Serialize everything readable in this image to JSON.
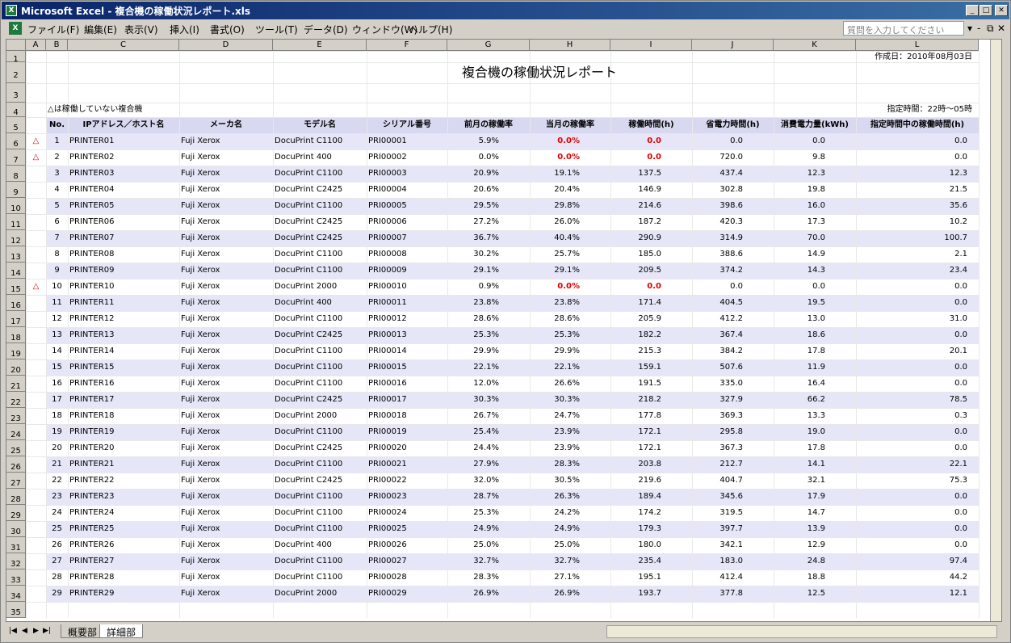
{
  "window": {
    "title": "Microsoft Excel - 複合機の稼働状況レポート.xls",
    "app_icon": "X"
  },
  "menu": {
    "items": [
      "ファイル(F)",
      "編集(E)",
      "表示(V)",
      "挿入(I)",
      "書式(O)",
      "ツール(T)",
      "データ(D)",
      "ウィンドウ(W)",
      "ヘルプ(H)"
    ],
    "help_placeholder": "質問を入力してください"
  },
  "columns": [
    "A",
    "B",
    "C",
    "D",
    "E",
    "F",
    "G",
    "H",
    "I",
    "J",
    "K",
    "L"
  ],
  "report": {
    "created": "作成日：2010年08月03日",
    "title": "複合機の稼働状況レポート",
    "legend": "△は稼働していない複合機",
    "time_range": "指定時間：22時～05時",
    "headers": [
      "No.",
      "IPアドレス／ホスト名",
      "メーカ名",
      "モデル名",
      "シリアル番号",
      "前月の稼働率",
      "当月の稼働率",
      "稼働時間(h)",
      "省電力時間(h)",
      "消費電力量(kWh)",
      "指定時間中の稼働時間(h)"
    ],
    "rows": [
      {
        "mark": "△",
        "no": "1",
        "host": "PRINTER01",
        "maker": "Fuji Xerox",
        "model": "DocuPrint C1100",
        "serial": "PRI00001",
        "prev": "5.9%",
        "curr": "0.0%",
        "hours": "0.0",
        "save": "0.0",
        "power": "0.0",
        "night": "0.0",
        "alert": true
      },
      {
        "mark": "△",
        "no": "2",
        "host": "PRINTER02",
        "maker": "Fuji Xerox",
        "model": "DocuPrint 400",
        "serial": "PRI00002",
        "prev": "0.0%",
        "curr": "0.0%",
        "hours": "0.0",
        "save": "720.0",
        "power": "9.8",
        "night": "0.0",
        "alert": true
      },
      {
        "mark": "",
        "no": "3",
        "host": "PRINTER03",
        "maker": "Fuji Xerox",
        "model": "DocuPrint C1100",
        "serial": "PRI00003",
        "prev": "20.9%",
        "curr": "19.1%",
        "hours": "137.5",
        "save": "437.4",
        "power": "12.3",
        "night": "12.3",
        "alert": false
      },
      {
        "mark": "",
        "no": "4",
        "host": "PRINTER04",
        "maker": "Fuji Xerox",
        "model": "DocuPrint C2425",
        "serial": "PRI00004",
        "prev": "20.6%",
        "curr": "20.4%",
        "hours": "146.9",
        "save": "302.8",
        "power": "19.8",
        "night": "21.5",
        "alert": false
      },
      {
        "mark": "",
        "no": "5",
        "host": "PRINTER05",
        "maker": "Fuji Xerox",
        "model": "DocuPrint C1100",
        "serial": "PRI00005",
        "prev": "29.5%",
        "curr": "29.8%",
        "hours": "214.6",
        "save": "398.6",
        "power": "16.0",
        "night": "35.6",
        "alert": false
      },
      {
        "mark": "",
        "no": "6",
        "host": "PRINTER06",
        "maker": "Fuji Xerox",
        "model": "DocuPrint C2425",
        "serial": "PRI00006",
        "prev": "27.2%",
        "curr": "26.0%",
        "hours": "187.2",
        "save": "420.3",
        "power": "17.3",
        "night": "10.2",
        "alert": false
      },
      {
        "mark": "",
        "no": "7",
        "host": "PRINTER07",
        "maker": "Fuji Xerox",
        "model": "DocuPrint C2425",
        "serial": "PRI00007",
        "prev": "36.7%",
        "curr": "40.4%",
        "hours": "290.9",
        "save": "314.9",
        "power": "70.0",
        "night": "100.7",
        "alert": false
      },
      {
        "mark": "",
        "no": "8",
        "host": "PRINTER08",
        "maker": "Fuji Xerox",
        "model": "DocuPrint C1100",
        "serial": "PRI00008",
        "prev": "30.2%",
        "curr": "25.7%",
        "hours": "185.0",
        "save": "388.6",
        "power": "14.9",
        "night": "2.1",
        "alert": false
      },
      {
        "mark": "",
        "no": "9",
        "host": "PRINTER09",
        "maker": "Fuji Xerox",
        "model": "DocuPrint C1100",
        "serial": "PRI00009",
        "prev": "29.1%",
        "curr": "29.1%",
        "hours": "209.5",
        "save": "374.2",
        "power": "14.3",
        "night": "23.4",
        "alert": false
      },
      {
        "mark": "△",
        "no": "10",
        "host": "PRINTER10",
        "maker": "Fuji Xerox",
        "model": "DocuPrint 2000",
        "serial": "PRI00010",
        "prev": "0.9%",
        "curr": "0.0%",
        "hours": "0.0",
        "save": "0.0",
        "power": "0.0",
        "night": "0.0",
        "alert": true
      },
      {
        "mark": "",
        "no": "11",
        "host": "PRINTER11",
        "maker": "Fuji Xerox",
        "model": "DocuPrint 400",
        "serial": "PRI00011",
        "prev": "23.8%",
        "curr": "23.8%",
        "hours": "171.4",
        "save": "404.5",
        "power": "19.5",
        "night": "0.0",
        "alert": false
      },
      {
        "mark": "",
        "no": "12",
        "host": "PRINTER12",
        "maker": "Fuji Xerox",
        "model": "DocuPrint C1100",
        "serial": "PRI00012",
        "prev": "28.6%",
        "curr": "28.6%",
        "hours": "205.9",
        "save": "412.2",
        "power": "13.0",
        "night": "31.0",
        "alert": false
      },
      {
        "mark": "",
        "no": "13",
        "host": "PRINTER13",
        "maker": "Fuji Xerox",
        "model": "DocuPrint C2425",
        "serial": "PRI00013",
        "prev": "25.3%",
        "curr": "25.3%",
        "hours": "182.2",
        "save": "367.4",
        "power": "18.6",
        "night": "0.0",
        "alert": false
      },
      {
        "mark": "",
        "no": "14",
        "host": "PRINTER14",
        "maker": "Fuji Xerox",
        "model": "DocuPrint C1100",
        "serial": "PRI00014",
        "prev": "29.9%",
        "curr": "29.9%",
        "hours": "215.3",
        "save": "384.2",
        "power": "17.8",
        "night": "20.1",
        "alert": false
      },
      {
        "mark": "",
        "no": "15",
        "host": "PRINTER15",
        "maker": "Fuji Xerox",
        "model": "DocuPrint C1100",
        "serial": "PRI00015",
        "prev": "22.1%",
        "curr": "22.1%",
        "hours": "159.1",
        "save": "507.6",
        "power": "11.9",
        "night": "0.0",
        "alert": false
      },
      {
        "mark": "",
        "no": "16",
        "host": "PRINTER16",
        "maker": "Fuji Xerox",
        "model": "DocuPrint C1100",
        "serial": "PRI00016",
        "prev": "12.0%",
        "curr": "26.6%",
        "hours": "191.5",
        "save": "335.0",
        "power": "16.4",
        "night": "0.0",
        "alert": false
      },
      {
        "mark": "",
        "no": "17",
        "host": "PRINTER17",
        "maker": "Fuji Xerox",
        "model": "DocuPrint C2425",
        "serial": "PRI00017",
        "prev": "30.3%",
        "curr": "30.3%",
        "hours": "218.2",
        "save": "327.9",
        "power": "66.2",
        "night": "78.5",
        "alert": false
      },
      {
        "mark": "",
        "no": "18",
        "host": "PRINTER18",
        "maker": "Fuji Xerox",
        "model": "DocuPrint 2000",
        "serial": "PRI00018",
        "prev": "26.7%",
        "curr": "24.7%",
        "hours": "177.8",
        "save": "369.3",
        "power": "13.3",
        "night": "0.3",
        "alert": false
      },
      {
        "mark": "",
        "no": "19",
        "host": "PRINTER19",
        "maker": "Fuji Xerox",
        "model": "DocuPrint C1100",
        "serial": "PRI00019",
        "prev": "25.4%",
        "curr": "23.9%",
        "hours": "172.1",
        "save": "295.8",
        "power": "19.0",
        "night": "0.0",
        "alert": false
      },
      {
        "mark": "",
        "no": "20",
        "host": "PRINTER20",
        "maker": "Fuji Xerox",
        "model": "DocuPrint C2425",
        "serial": "PRI00020",
        "prev": "24.4%",
        "curr": "23.9%",
        "hours": "172.1",
        "save": "367.3",
        "power": "17.8",
        "night": "0.0",
        "alert": false
      },
      {
        "mark": "",
        "no": "21",
        "host": "PRINTER21",
        "maker": "Fuji Xerox",
        "model": "DocuPrint C1100",
        "serial": "PRI00021",
        "prev": "27.9%",
        "curr": "28.3%",
        "hours": "203.8",
        "save": "212.7",
        "power": "14.1",
        "night": "22.1",
        "alert": false
      },
      {
        "mark": "",
        "no": "22",
        "host": "PRINTER22",
        "maker": "Fuji Xerox",
        "model": "DocuPrint C2425",
        "serial": "PRI00022",
        "prev": "32.0%",
        "curr": "30.5%",
        "hours": "219.6",
        "save": "404.7",
        "power": "32.1",
        "night": "75.3",
        "alert": false
      },
      {
        "mark": "",
        "no": "23",
        "host": "PRINTER23",
        "maker": "Fuji Xerox",
        "model": "DocuPrint C1100",
        "serial": "PRI00023",
        "prev": "28.7%",
        "curr": "26.3%",
        "hours": "189.4",
        "save": "345.6",
        "power": "17.9",
        "night": "0.0",
        "alert": false
      },
      {
        "mark": "",
        "no": "24",
        "host": "PRINTER24",
        "maker": "Fuji Xerox",
        "model": "DocuPrint C1100",
        "serial": "PRI00024",
        "prev": "25.3%",
        "curr": "24.2%",
        "hours": "174.2",
        "save": "319.5",
        "power": "14.7",
        "night": "0.0",
        "alert": false
      },
      {
        "mark": "",
        "no": "25",
        "host": "PRINTER25",
        "maker": "Fuji Xerox",
        "model": "DocuPrint C1100",
        "serial": "PRI00025",
        "prev": "24.9%",
        "curr": "24.9%",
        "hours": "179.3",
        "save": "397.7",
        "power": "13.9",
        "night": "0.0",
        "alert": false
      },
      {
        "mark": "",
        "no": "26",
        "host": "PRINTER26",
        "maker": "Fuji Xerox",
        "model": "DocuPrint 400",
        "serial": "PRI00026",
        "prev": "25.0%",
        "curr": "25.0%",
        "hours": "180.0",
        "save": "342.1",
        "power": "12.9",
        "night": "0.0",
        "alert": false
      },
      {
        "mark": "",
        "no": "27",
        "host": "PRINTER27",
        "maker": "Fuji Xerox",
        "model": "DocuPrint C1100",
        "serial": "PRI00027",
        "prev": "32.7%",
        "curr": "32.7%",
        "hours": "235.4",
        "save": "183.0",
        "power": "24.8",
        "night": "97.4",
        "alert": false
      },
      {
        "mark": "",
        "no": "28",
        "host": "PRINTER28",
        "maker": "Fuji Xerox",
        "model": "DocuPrint C1100",
        "serial": "PRI00028",
        "prev": "28.3%",
        "curr": "27.1%",
        "hours": "195.1",
        "save": "412.4",
        "power": "18.8",
        "night": "44.2",
        "alert": false
      },
      {
        "mark": "",
        "no": "29",
        "host": "PRINTER29",
        "maker": "Fuji Xerox",
        "model": "DocuPrint 2000",
        "serial": "PRI00029",
        "prev": "26.9%",
        "curr": "26.9%",
        "hours": "193.7",
        "save": "377.8",
        "power": "12.5",
        "night": "12.1",
        "alert": false
      }
    ]
  },
  "tabs": [
    "概要部",
    "詳細部"
  ],
  "active_tab": 1,
  "colors": {
    "band": "#e6e6f8",
    "alert": "#e00000",
    "title_bar": "#0a246a"
  }
}
